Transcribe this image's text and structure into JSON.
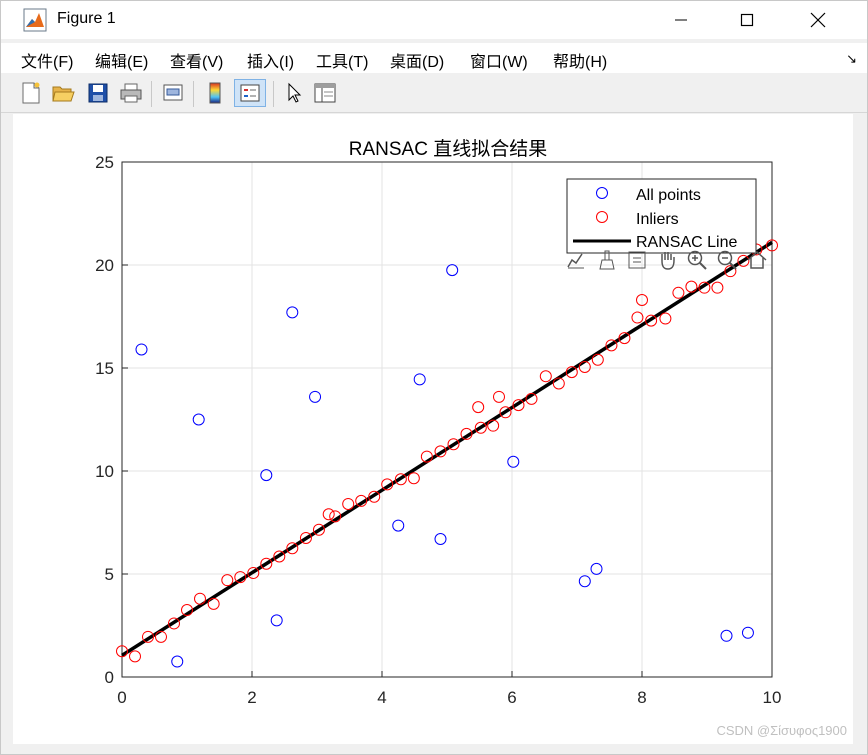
{
  "window": {
    "title": "Figure 1"
  },
  "menu": {
    "items": [
      "文件(F)",
      "编辑(E)",
      "查看(V)",
      "插入(I)",
      "工具(T)",
      "桌面(D)",
      "窗口(W)",
      "帮助(H)"
    ],
    "dock_arrow": "↘"
  },
  "toolbar": {
    "buttons": [
      "new-figure-icon",
      "open-file-icon",
      "save-icon",
      "print-icon",
      "print-preview-icon",
      "colorbar-icon",
      "legend-icon",
      "pointer-icon",
      "property-inspector-icon"
    ]
  },
  "axes_toolbar": {
    "buttons": [
      "brush-export-icon",
      "data-brush-icon",
      "data-tips-icon",
      "pan-hand-icon",
      "zoom-in-icon",
      "zoom-out-icon",
      "home-icon"
    ]
  },
  "watermark": "CSDN @Σίσυφος1900",
  "chart_data": {
    "type": "scatter",
    "title": "RANSAC 直线拟合结果",
    "xlabel": "",
    "ylabel": "",
    "xlim": [
      0,
      10
    ],
    "ylim": [
      0,
      25
    ],
    "xticks": [
      "0",
      "2",
      "4",
      "6",
      "8",
      "10"
    ],
    "yticks": [
      "0",
      "5",
      "10",
      "15",
      "20",
      "25"
    ],
    "grid": true,
    "legend_position": "top-right",
    "legend": [
      "All points",
      "Inliers",
      "RANSAC Line"
    ],
    "colors": {
      "all_points": "#0000ff",
      "inliers": "#ff0000",
      "line": "#000000"
    },
    "series": [
      {
        "name": "All points",
        "marker": "circle-open",
        "outliers_only_visible": true,
        "points": [
          [
            0.3,
            15.9
          ],
          [
            0.85,
            0.75
          ],
          [
            1.18,
            12.5
          ],
          [
            2.22,
            9.8
          ],
          [
            2.38,
            2.75
          ],
          [
            2.62,
            17.7
          ],
          [
            2.97,
            13.6
          ],
          [
            4.25,
            7.35
          ],
          [
            4.58,
            14.45
          ],
          [
            4.9,
            6.7
          ],
          [
            5.08,
            19.75
          ],
          [
            6.02,
            10.45
          ],
          [
            7.12,
            4.65
          ],
          [
            7.3,
            5.25
          ],
          [
            9.3,
            2.0
          ],
          [
            9.63,
            2.15
          ]
        ]
      },
      {
        "name": "Inliers",
        "marker": "circle-open",
        "points": [
          [
            0.0,
            1.25
          ],
          [
            0.2,
            1.0
          ],
          [
            0.4,
            1.95
          ],
          [
            0.6,
            1.95
          ],
          [
            0.8,
            2.6
          ],
          [
            1.0,
            3.25
          ],
          [
            1.2,
            3.8
          ],
          [
            1.41,
            3.55
          ],
          [
            1.62,
            4.7
          ],
          [
            1.82,
            4.85
          ],
          [
            2.02,
            5.05
          ],
          [
            2.22,
            5.5
          ],
          [
            2.42,
            5.85
          ],
          [
            2.62,
            6.25
          ],
          [
            2.83,
            6.75
          ],
          [
            3.03,
            7.15
          ],
          [
            3.18,
            7.9
          ],
          [
            3.28,
            7.8
          ],
          [
            3.48,
            8.4
          ],
          [
            3.68,
            8.55
          ],
          [
            3.88,
            8.75
          ],
          [
            4.08,
            9.35
          ],
          [
            4.29,
            9.6
          ],
          [
            4.49,
            9.65
          ],
          [
            4.69,
            10.7
          ],
          [
            4.9,
            10.95
          ],
          [
            5.1,
            11.3
          ],
          [
            5.3,
            11.8
          ],
          [
            5.48,
            13.1
          ],
          [
            5.52,
            12.1
          ],
          [
            5.71,
            12.2
          ],
          [
            5.8,
            13.6
          ],
          [
            5.9,
            12.85
          ],
          [
            6.1,
            13.2
          ],
          [
            6.3,
            13.5
          ],
          [
            6.52,
            14.6
          ],
          [
            6.72,
            14.25
          ],
          [
            6.92,
            14.8
          ],
          [
            7.12,
            15.05
          ],
          [
            7.32,
            15.4
          ],
          [
            7.53,
            16.1
          ],
          [
            7.73,
            16.45
          ],
          [
            7.93,
            17.45
          ],
          [
            8.0,
            18.3
          ],
          [
            8.14,
            17.3
          ],
          [
            8.36,
            17.4
          ],
          [
            8.56,
            18.65
          ],
          [
            8.76,
            18.95
          ],
          [
            8.96,
            18.9
          ],
          [
            9.16,
            18.9
          ],
          [
            9.36,
            19.7
          ],
          [
            9.56,
            20.2
          ],
          [
            9.76,
            20.75
          ],
          [
            10.0,
            20.95
          ]
        ]
      },
      {
        "name": "RANSAC Line",
        "type": "line",
        "points": [
          [
            0.0,
            1.05
          ],
          [
            10.0,
            21.1
          ]
        ]
      }
    ]
  }
}
